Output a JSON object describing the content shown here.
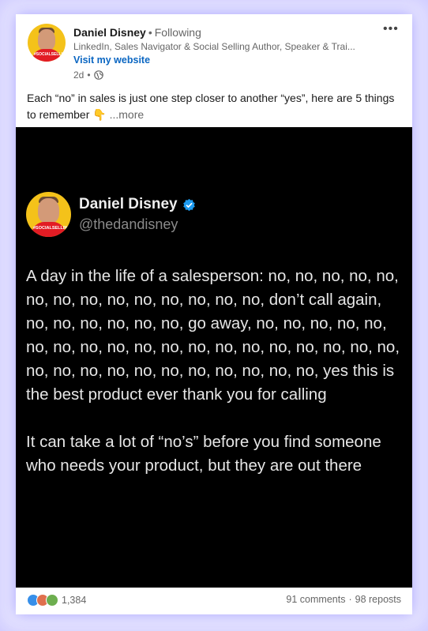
{
  "post": {
    "author_name": "Daniel Disney",
    "following": "Following",
    "headline": "LinkedIn, Sales Navigator & Social Selling Author, Speaker & Trai...",
    "visit_website": "Visit my website",
    "time": "2d",
    "visibility_icon": "globe-icon",
    "text": "Each “no” in sales is just one step closer to another “yes”, here are 5 things to remember 👇",
    "more": "...more",
    "avatar_shirt_text": "#SOCIALSELLIN"
  },
  "image": {
    "name": "Daniel Disney",
    "handle": "@thedandisney",
    "verified_icon": "verified-badge-icon",
    "paragraph1": "A day in the life of a salesperson: no, no, no, no, no, no, no, no, no, no, no, no, no, no, don’t call again, no, no, no, no, no, no, go away, no, no, no, no, no, no, no, no, no, no, no, no, no, no, no, no, no, no, no, no, no, no, no, no, no, no, no, no, no, no, yes this is the best product ever thank you for calling",
    "paragraph2": "It can take a lot of “no’s” before you find someone who needs your product, but they are out there"
  },
  "footer": {
    "reaction_icons": [
      "like-icon",
      "love-icon",
      "celebrate-icon"
    ],
    "reaction_count": "1,384",
    "comments": "91 comments",
    "separator": "·",
    "reposts": "98 reposts"
  },
  "colors": {
    "link": "#0a66c2",
    "image_bg": "#000000",
    "frame_glow": "#6e64ff"
  }
}
